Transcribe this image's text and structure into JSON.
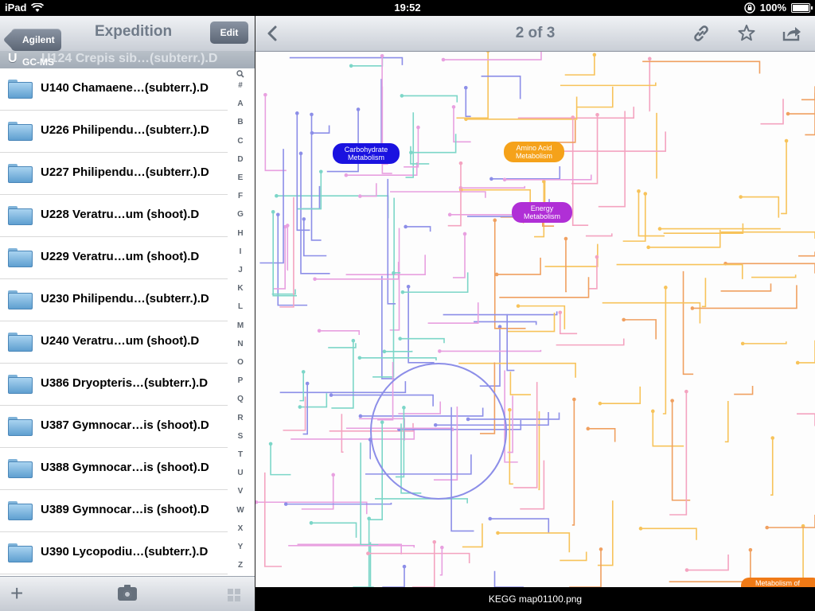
{
  "status_bar": {
    "device": "iPad",
    "time": "19:52",
    "battery": "100%"
  },
  "master": {
    "back_label": "Agilent GC-MS",
    "title": "Expedition",
    "edit_label": "Edit",
    "section_letter": "U",
    "section_peek": "U124 Crepis sib…(subterr.).D",
    "items": [
      "U140 Chamaene…(subterr.).D",
      "U226 Philipendu…(subterr.).D",
      "U227 Philipendu…(subterr.).D",
      "U228 Veratru…um (shoot).D",
      "U229 Veratru…um (shoot).D",
      "U230 Philipendu…(subterr.).D",
      "U240 Veratru…um (shoot).D",
      "U386 Dryopteris…(subterr.).D",
      "U387 Gymnocar…is (shoot).D",
      "U388 Gymnocar…is (shoot).D",
      "U389 Gymnocar…is (shoot).D",
      "U390 Lycopodiu…(subterr.).D"
    ],
    "index_letters": [
      "#",
      "A",
      "B",
      "C",
      "D",
      "E",
      "F",
      "G",
      "H",
      "I",
      "J",
      "K",
      "L",
      "M",
      "N",
      "O",
      "P",
      "Q",
      "R",
      "S",
      "T",
      "U",
      "V",
      "W",
      "X",
      "Y",
      "Z"
    ],
    "toolbar": {
      "add_icon": "plus-icon",
      "camera_icon": "camera-icon",
      "grid_icon": "grid-icon"
    }
  },
  "detail": {
    "title": "2 of 3",
    "caption": "KEGG map01100.png",
    "icons": [
      "back-chevron-icon",
      "link-icon",
      "star-icon",
      "share-icon"
    ],
    "map_labels": {
      "carbohydrate": "Carbohydrate Metabolism",
      "amino": "Amino Acid Metabolism",
      "energy": "Energy Metabolism",
      "other": "Metabolism of Other Amino Acids"
    },
    "colors": {
      "carbohydrate": "#1a12e0",
      "amino": "#f5a21a",
      "energy": "#b02fd6",
      "other": "#f07a16"
    }
  }
}
